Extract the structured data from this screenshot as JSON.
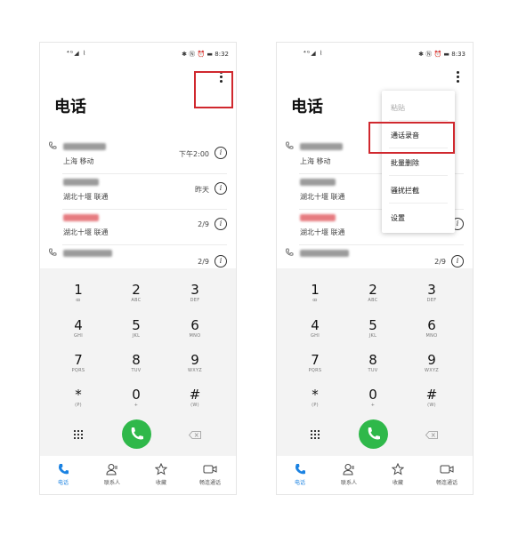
{
  "status_bar": {
    "left_icons": "⁴ᴳ◢ ⌇",
    "right_icons": "✱ Ⓝ ⏰ ▬",
    "time": "8:32"
  },
  "status_bar_right_panel": {
    "time": "8:33"
  },
  "header": {
    "title": "电话",
    "more_icon": "more-vertical-icon"
  },
  "call_log": [
    {
      "name_blur_color": "#8a8a8a",
      "location": "上海 移动",
      "time": "下午2:00"
    },
    {
      "name_blur_color": "#8a8a8a",
      "location": "湖北十堰 联通",
      "time": "昨天"
    },
    {
      "name_blur_color": "#e2646a",
      "location": "湖北十堰 联通",
      "time": "2/9"
    },
    {
      "name_blur_color": "#8a8a8a",
      "location": "",
      "time": "2/9"
    }
  ],
  "dialpad": {
    "keys": [
      {
        "digit": "1",
        "letters": "ꝏ"
      },
      {
        "digit": "2",
        "letters": "ABC"
      },
      {
        "digit": "3",
        "letters": "DEF"
      },
      {
        "digit": "4",
        "letters": "GHI"
      },
      {
        "digit": "5",
        "letters": "JKL"
      },
      {
        "digit": "6",
        "letters": "MNO"
      },
      {
        "digit": "7",
        "letters": "PQRS"
      },
      {
        "digit": "8",
        "letters": "TUV"
      },
      {
        "digit": "9",
        "letters": "WXYZ"
      },
      {
        "digit": "*",
        "letters": "(P)"
      },
      {
        "digit": "0",
        "letters": "+"
      },
      {
        "digit": "#",
        "letters": "(W)"
      }
    ]
  },
  "tabs": [
    {
      "label": "电话",
      "icon": "phone-icon",
      "active": true
    },
    {
      "label": "联系人",
      "icon": "contacts-icon",
      "active": false
    },
    {
      "label": "收藏",
      "icon": "star-icon",
      "active": false
    },
    {
      "label": "畅连通话",
      "icon": "video-call-icon",
      "active": false
    }
  ],
  "overflow_menu": {
    "items": [
      {
        "label": "粘贴",
        "enabled": false
      },
      {
        "label": "通话录音",
        "enabled": true,
        "highlighted": true
      },
      {
        "label": "批量删除",
        "enabled": true
      },
      {
        "label": "骚扰拦截",
        "enabled": true
      },
      {
        "label": "设置",
        "enabled": true
      }
    ]
  },
  "colors": {
    "accent": "#1a82e2",
    "call_green": "#2fb84a",
    "highlight_red": "#d0282e",
    "dialpad_bg": "#f3f3f3"
  }
}
